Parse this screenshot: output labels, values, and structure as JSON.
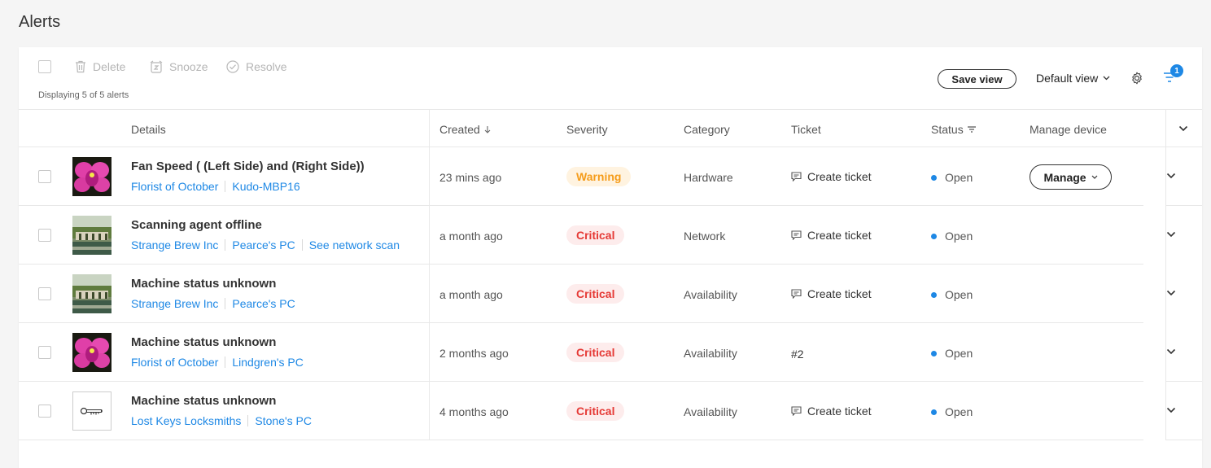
{
  "page": {
    "title": "Alerts"
  },
  "toolbar": {
    "delete_label": "Delete",
    "snooze_label": "Snooze",
    "resolve_label": "Resolve",
    "displaying": "Displaying 5 of 5 alerts",
    "save_view_label": "Save view",
    "default_view_label": "Default view",
    "filter_count": "1"
  },
  "columns": {
    "details": "Details",
    "created": "Created",
    "severity": "Severity",
    "category": "Category",
    "ticket": "Ticket",
    "status": "Status",
    "manage_device": "Manage device"
  },
  "colors": {
    "link": "#1e88e5",
    "critical": "#e53935",
    "warning": "#f59c1a",
    "status_dot": "#1e88e5"
  },
  "rows": [
    {
      "thumb": "orchid",
      "title": "Fan Speed ( (Left Side) and (Right Side))",
      "links": [
        "Florist of October",
        "Kudo-MBP16"
      ],
      "created": "23 mins ago",
      "severity": "Warning",
      "category": "Hardware",
      "ticket": "Create ticket",
      "status": "Open",
      "manage_label": "Manage"
    },
    {
      "thumb": "garden",
      "title": "Scanning agent offline",
      "links": [
        "Strange Brew Inc",
        "Pearce's PC",
        "See network scan"
      ],
      "created": "a month ago",
      "severity": "Critical",
      "category": "Network",
      "ticket": "Create ticket",
      "status": "Open"
    },
    {
      "thumb": "garden",
      "title": "Machine status unknown",
      "links": [
        "Strange Brew Inc",
        "Pearce's PC"
      ],
      "created": "a month ago",
      "severity": "Critical",
      "category": "Availability",
      "ticket": "Create ticket",
      "status": "Open"
    },
    {
      "thumb": "orchid",
      "title": "Machine status unknown",
      "links": [
        "Florist of October",
        "Lindgren's PC"
      ],
      "created": "2 months ago",
      "severity": "Critical",
      "category": "Availability",
      "ticket": "#2",
      "status": "Open"
    },
    {
      "thumb": "key",
      "title": "Machine status unknown",
      "links": [
        "Lost Keys Locksmiths",
        "Stone's PC"
      ],
      "created": "4 months ago",
      "severity": "Critical",
      "category": "Availability",
      "ticket": "Create ticket",
      "status": "Open"
    }
  ]
}
